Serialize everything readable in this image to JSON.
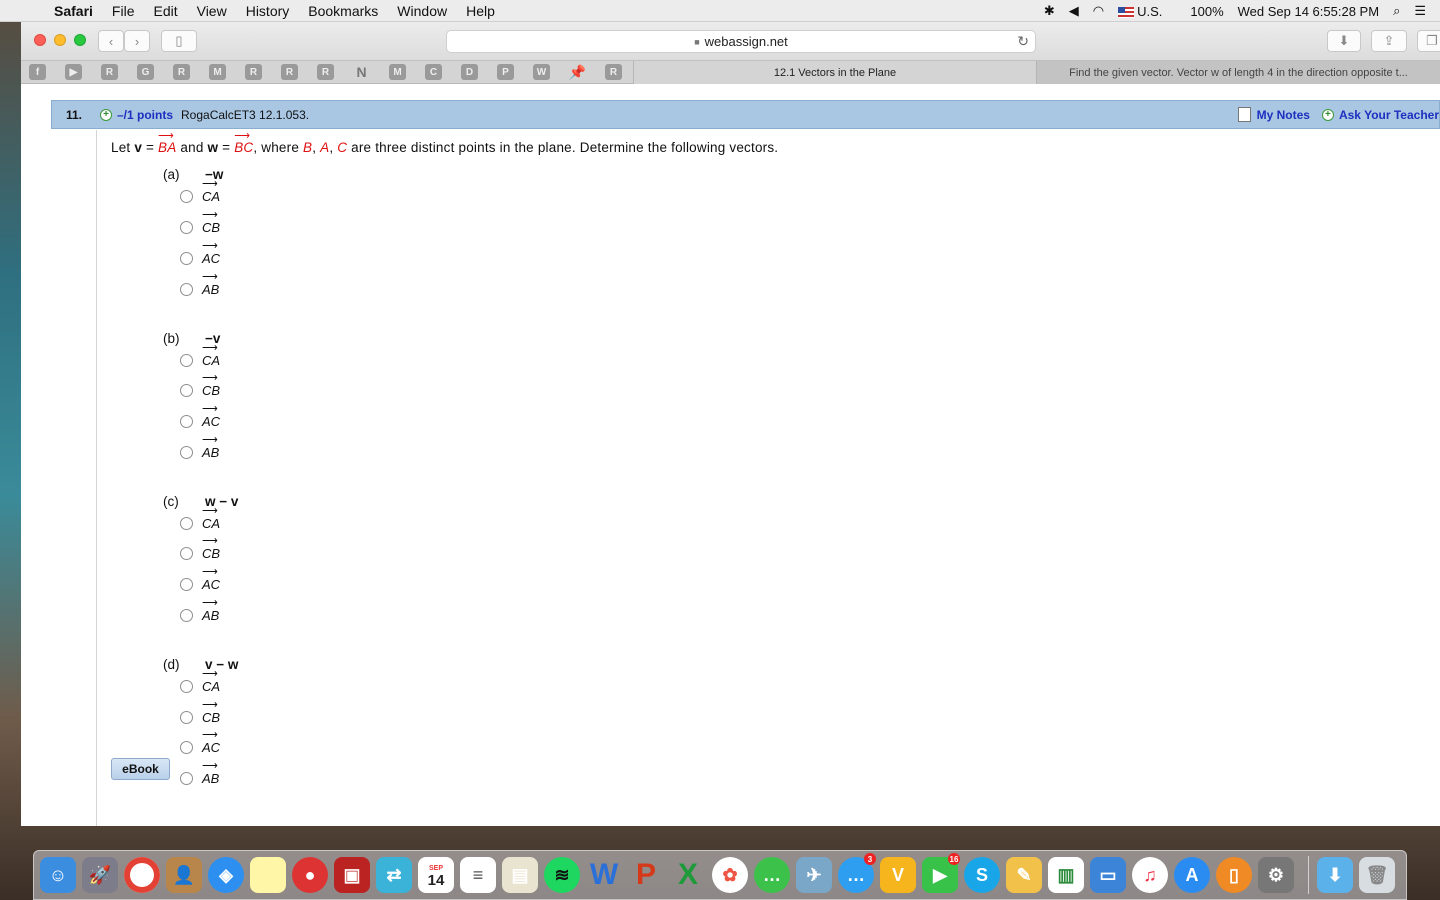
{
  "menubar": {
    "app": "Safari",
    "items": [
      "File",
      "Edit",
      "View",
      "History",
      "Bookmarks",
      "Window",
      "Help"
    ],
    "keyboard": "U.S.",
    "battery": "100%",
    "clock": "Wed Sep 14  6:55:28 PM"
  },
  "browser": {
    "url": "webassign.net",
    "favorites": [
      "f",
      "▶",
      "R",
      "G",
      "R",
      "M",
      "R",
      "R",
      "R",
      "N",
      "M",
      "C",
      "D",
      "P",
      "W",
      "📌",
      "R"
    ],
    "tabs": [
      {
        "title": "12.1 Vectors in the Plane",
        "active": true
      },
      {
        "title": "Find the given vector. Vector w of length 4 in the direction opposite t...",
        "active": false
      }
    ]
  },
  "question": {
    "number": "11.",
    "points": "–/1 points",
    "id": "RogaCalcET3 12.1.053.",
    "my_notes": "My Notes",
    "ask_teacher": "Ask Your Teacher",
    "prompt": {
      "let": "Let",
      "v": "v",
      "eq": "=",
      "ba": "BA",
      "and": "and",
      "w": "w",
      "bc": "BC",
      "where": ",  where",
      "B": "B",
      "A": "A",
      "C": "C",
      "rest": "are three distinct points in the plane. Determine the following vectors."
    },
    "parts": [
      {
        "label": "(a)",
        "expr": "−w",
        "options": [
          "CA",
          "CB",
          "AC",
          "AB"
        ]
      },
      {
        "label": "(b)",
        "expr": "−v",
        "options": [
          "CA",
          "CB",
          "AC",
          "AB"
        ]
      },
      {
        "label": "(c)",
        "expr": "w − v",
        "options": [
          "CA",
          "CB",
          "AC",
          "AB"
        ]
      },
      {
        "label": "(d)",
        "expr": "v − w",
        "options": [
          "CA",
          "CB",
          "AC",
          "AB"
        ]
      }
    ],
    "ebook": "eBook"
  },
  "dock": {
    "calendar_month": "SEP",
    "calendar_day": "14",
    "messages_badge": "3",
    "facetime_badge": "16"
  }
}
